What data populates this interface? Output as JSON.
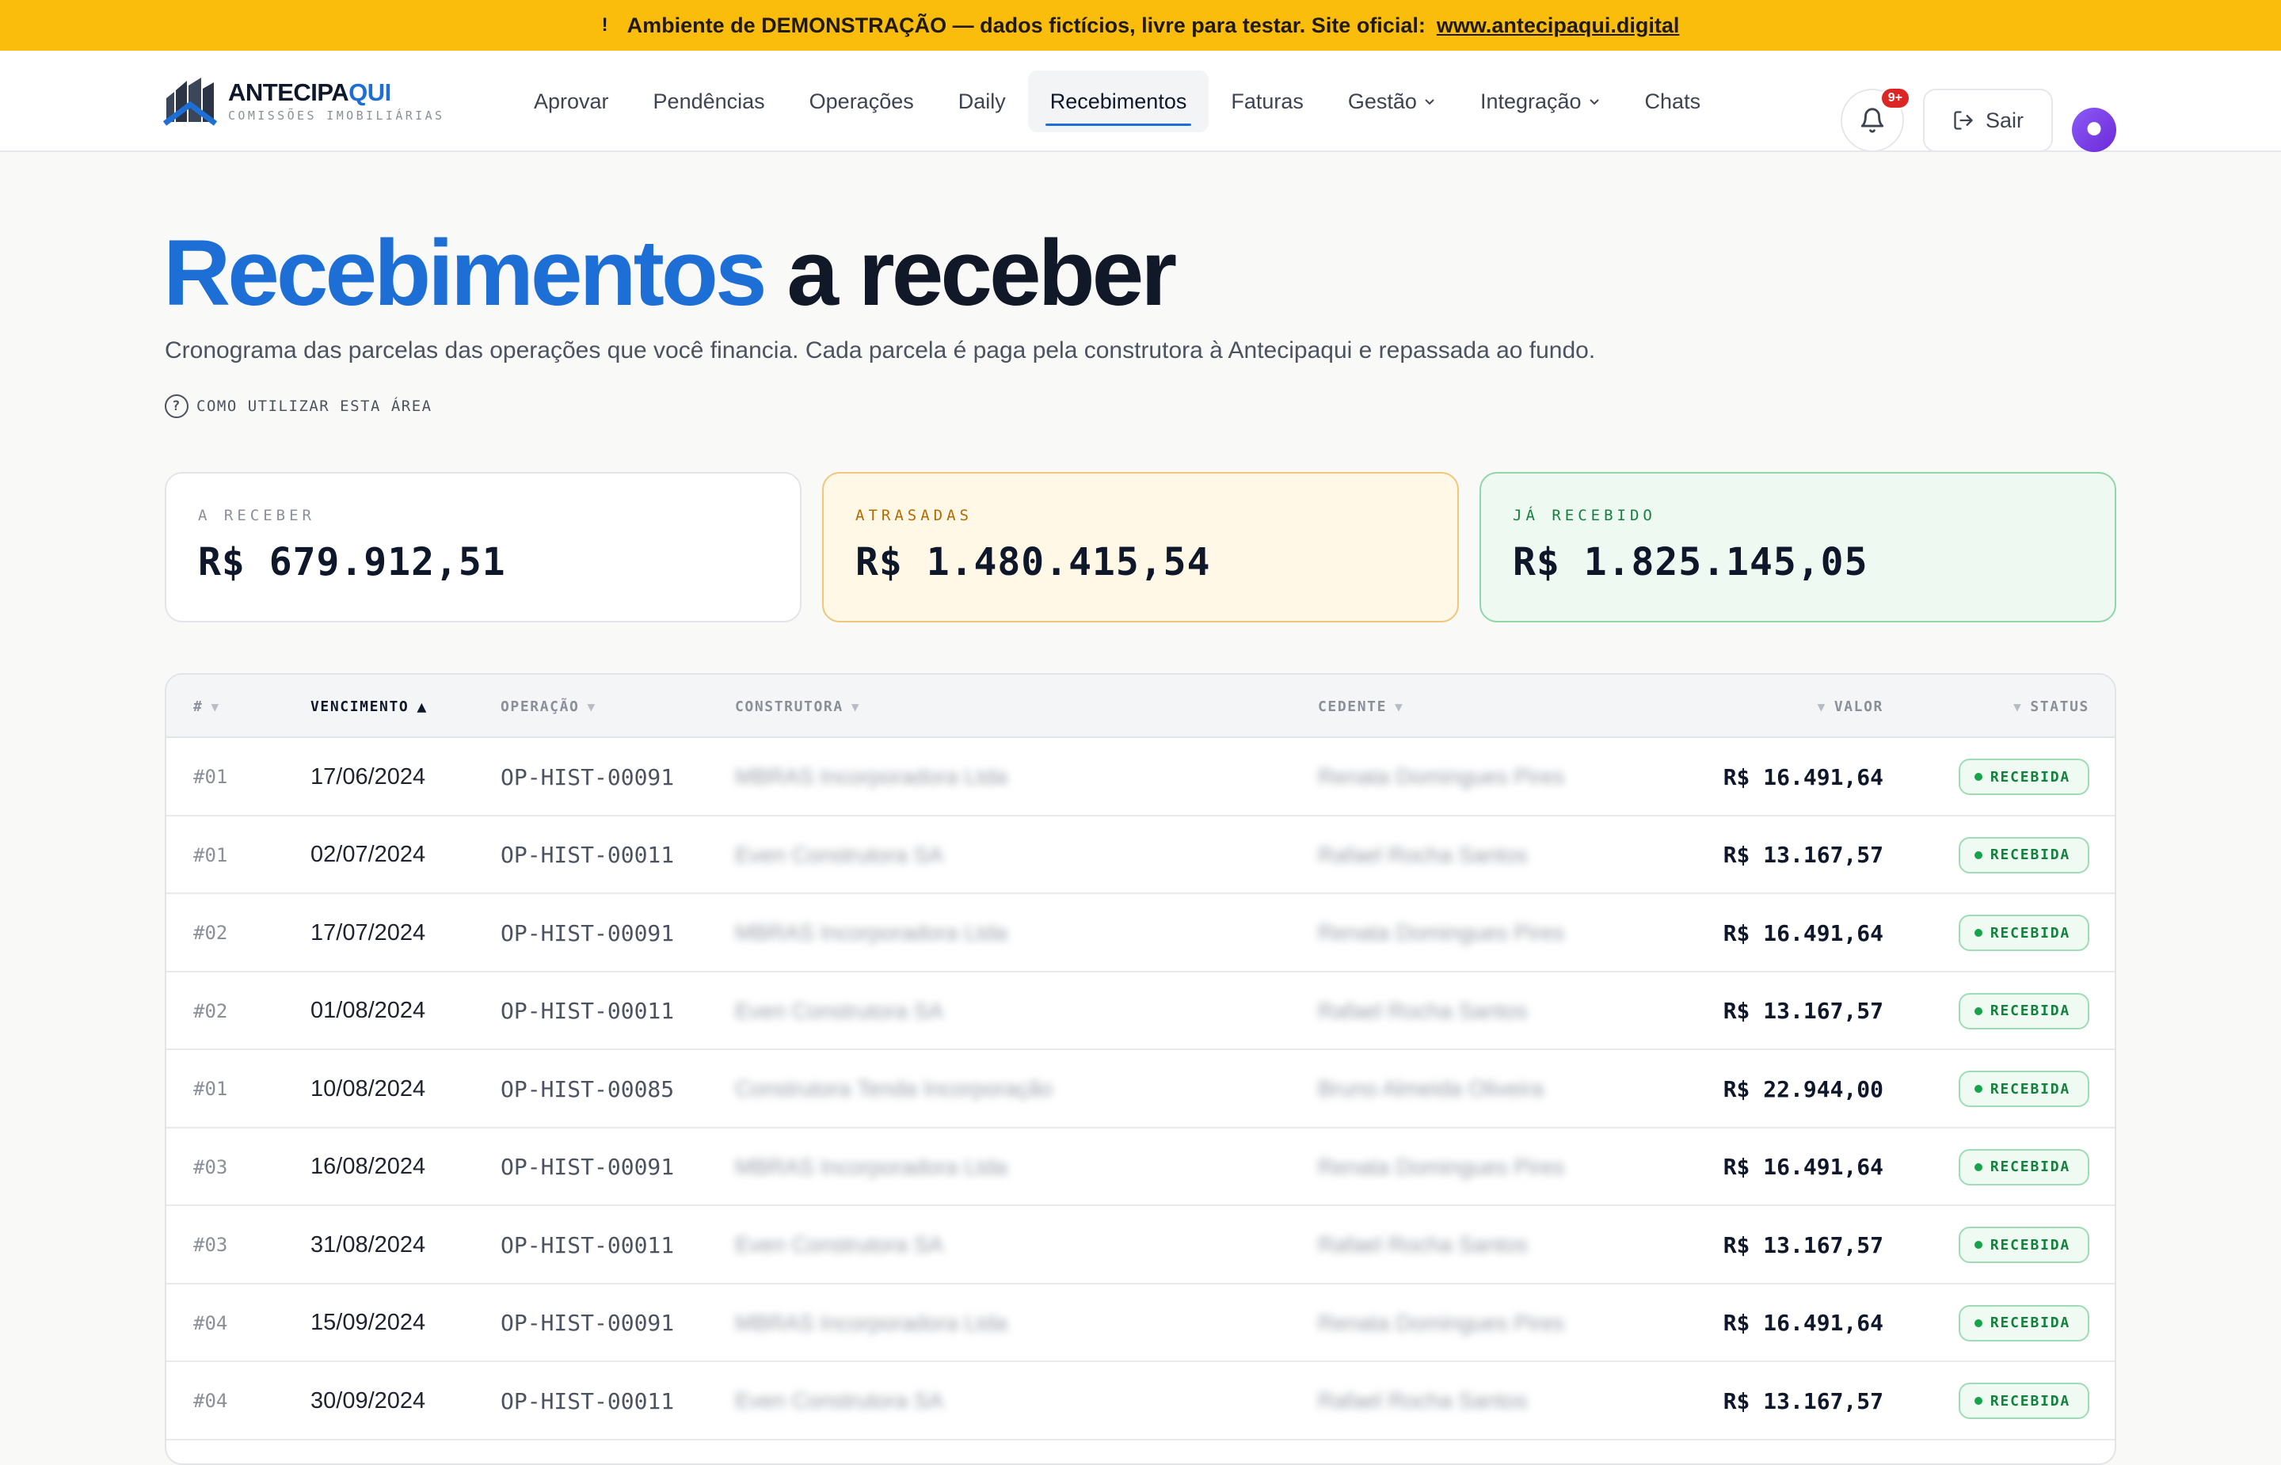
{
  "banner": {
    "icon": "warning-icon",
    "text": "Ambiente de DEMONSTRAÇÃO — dados fictícios, livre para testar. Site oficial:",
    "link": "www.antecipaqui.digital"
  },
  "logo": {
    "name_a": "ANTECIPA",
    "name_b": "QUI",
    "tagline": "COMISSÕES IMOBILIÁRIAS"
  },
  "nav": {
    "items": [
      {
        "label": "Aprovar"
      },
      {
        "label": "Pendências"
      },
      {
        "label": "Operações"
      },
      {
        "label": "Daily"
      },
      {
        "label": "Recebimentos",
        "active": true
      },
      {
        "label": "Faturas"
      },
      {
        "label": "Gestão",
        "dropdown": true
      },
      {
        "label": "Integração",
        "dropdown": true
      },
      {
        "label": "Chats"
      }
    ]
  },
  "header": {
    "notifications_badge": "9+",
    "logout_label": "Sair"
  },
  "page": {
    "title_highlight": "Recebimentos",
    "title_rest": "a receber",
    "subtitle": "Cronograma das parcelas das operações que você financia. Cada parcela é paga pela construtora à Antecipaqui e repassada ao fundo.",
    "help_icon": "?",
    "help_label": "COMO UTILIZAR ESTA ÁREA"
  },
  "summary": {
    "a_receber": {
      "label": "A RECEBER",
      "value": "R$ 679.912,51"
    },
    "atrasadas": {
      "label": "ATRASADAS",
      "value": "R$ 1.480.415,54"
    },
    "ja_recebido": {
      "label": "JÁ RECEBIDO",
      "value": "R$ 1.825.145,05"
    }
  },
  "table": {
    "columns": {
      "num": "#",
      "vencimento": "VENCIMENTO",
      "operacao": "OPERAÇÃO",
      "construtora": "CONSTRUTORA",
      "cedente": "CEDENTE",
      "valor": "VALOR",
      "status": "STATUS"
    },
    "sort_asc_arrow": "▲",
    "sort_arrow": "▼",
    "rows": [
      {
        "num": "#01",
        "date": "17/06/2024",
        "op": "OP-HIST-00091",
        "construtora": "MBRAS Incorporadora Ltda",
        "cedente": "Renata Domingues Pires",
        "value": "R$ 16.491,64",
        "status": "RECEBIDA"
      },
      {
        "num": "#01",
        "date": "02/07/2024",
        "op": "OP-HIST-00011",
        "construtora": "Even Construtora SA",
        "cedente": "Rafael Rocha Santos",
        "value": "R$ 13.167,57",
        "status": "RECEBIDA"
      },
      {
        "num": "#02",
        "date": "17/07/2024",
        "op": "OP-HIST-00091",
        "construtora": "MBRAS Incorporadora Ltda",
        "cedente": "Renata Domingues Pires",
        "value": "R$ 16.491,64",
        "status": "RECEBIDA"
      },
      {
        "num": "#02",
        "date": "01/08/2024",
        "op": "OP-HIST-00011",
        "construtora": "Even Construtora SA",
        "cedente": "Rafael Rocha Santos",
        "value": "R$ 13.167,57",
        "status": "RECEBIDA"
      },
      {
        "num": "#01",
        "date": "10/08/2024",
        "op": "OP-HIST-00085",
        "construtora": "Construtora Tenda Incorporação",
        "cedente": "Bruno Almeida Oliveira",
        "value": "R$ 22.944,00",
        "status": "RECEBIDA"
      },
      {
        "num": "#03",
        "date": "16/08/2024",
        "op": "OP-HIST-00091",
        "construtora": "MBRAS Incorporadora Ltda",
        "cedente": "Renata Domingues Pires",
        "value": "R$ 16.491,64",
        "status": "RECEBIDA"
      },
      {
        "num": "#03",
        "date": "31/08/2024",
        "op": "OP-HIST-00011",
        "construtora": "Even Construtora SA",
        "cedente": "Rafael Rocha Santos",
        "value": "R$ 13.167,57",
        "status": "RECEBIDA"
      },
      {
        "num": "#04",
        "date": "15/09/2024",
        "op": "OP-HIST-00091",
        "construtora": "MBRAS Incorporadora Ltda",
        "cedente": "Renata Domingues Pires",
        "value": "R$ 16.491,64",
        "status": "RECEBIDA"
      },
      {
        "num": "#04",
        "date": "30/09/2024",
        "op": "OP-HIST-00011",
        "construtora": "Even Construtora SA",
        "cedente": "Rafael Rocha Santos",
        "value": "R$ 13.167,57",
        "status": "RECEBIDA"
      }
    ]
  },
  "colors": {
    "accent": "#1d6fd6",
    "banner": "#fbbd0c",
    "success": "#15803d",
    "warning": "#b26a00"
  }
}
